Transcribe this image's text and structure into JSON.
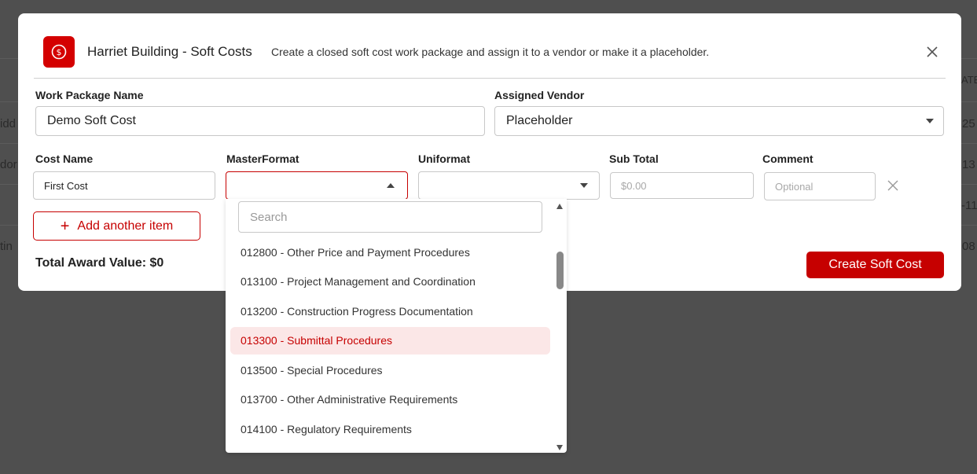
{
  "background": {
    "fragments": [
      "ATE",
      "idd",
      "25",
      "dor",
      "13",
      "-11",
      "tin",
      "08"
    ]
  },
  "header": {
    "icon": "dollar-circle-icon",
    "title": "Harriet Building - Soft Costs",
    "subtitle": "Create a closed soft cost work package and assign it to a vendor or make it a placeholder."
  },
  "form": {
    "work_package_label": "Work Package Name",
    "work_package_value": "Demo Soft Cost",
    "vendor_label": "Assigned Vendor",
    "vendor_value": "Placeholder",
    "columns": {
      "cost_name": "Cost Name",
      "masterformat": "MasterFormat",
      "uniformat": "Uniformat",
      "sub_total": "Sub Total",
      "comment": "Comment"
    },
    "row": {
      "cost_name_value": "First Cost",
      "masterformat_value": "",
      "uniformat_value": "",
      "sub_total_placeholder": "$0.00",
      "comment_placeholder": "Optional"
    },
    "add_item_label": "Add another item",
    "total_label": "Total Award Value: $0",
    "create_label": "Create Soft Cost"
  },
  "dropdown": {
    "search_placeholder": "Search",
    "options": [
      "012800 - Other Price and Payment Procedures",
      "013100 - Project Management and Coordination",
      "013200 - Construction Progress Documentation",
      "013300 - Submittal Procedures",
      "013500 - Special Procedures",
      "013700 - Other Administrative Requirements",
      "014100 - Regulatory Requirements"
    ],
    "highlighted_index": 3
  },
  "colors": {
    "accent": "#c60000",
    "highlight_bg": "#fbe7e7",
    "overlay": "#4f4f4f"
  }
}
